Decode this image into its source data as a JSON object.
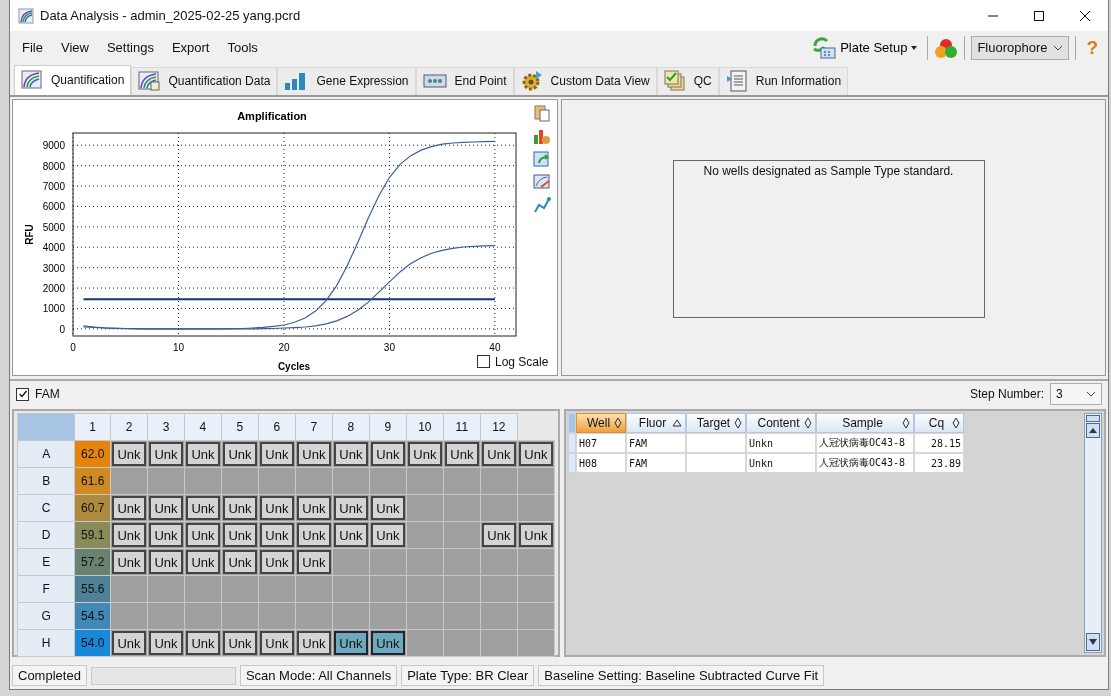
{
  "window": {
    "title": "Data Analysis - admin_2025-02-25 yang.pcrd"
  },
  "menu": [
    "File",
    "View",
    "Settings",
    "Export",
    "Tools"
  ],
  "toolbar": {
    "plate_setup": "Plate Setup",
    "fluorophore_select": "Fluorophore",
    "help": "?"
  },
  "tabs": [
    {
      "label": "Quantification",
      "selected": true
    },
    {
      "label": "Quantification Data",
      "selected": false
    },
    {
      "label": "Gene Expression",
      "selected": false
    },
    {
      "label": "End Point",
      "selected": false
    },
    {
      "label": "Custom Data View",
      "selected": false
    },
    {
      "label": "QC",
      "selected": false
    },
    {
      "label": "Run Information",
      "selected": false
    }
  ],
  "amplification": {
    "log_scale": {
      "label": "Log Scale",
      "checked": false
    },
    "chart_data": {
      "type": "line",
      "title": "Amplification",
      "xlabel": "Cycles",
      "ylabel": "RFU",
      "grid": true,
      "x": [
        1,
        2,
        3,
        4,
        5,
        6,
        7,
        8,
        9,
        10,
        11,
        12,
        13,
        14,
        15,
        16,
        17,
        18,
        19,
        20,
        21,
        22,
        23,
        24,
        25,
        26,
        27,
        28,
        29,
        30,
        31,
        32,
        33,
        34,
        35,
        36,
        37,
        38,
        39,
        40
      ],
      "series": [
        {
          "color": "#3b5f96",
          "values": [
            150,
            90,
            50,
            30,
            20,
            10,
            0,
            0,
            0,
            0,
            0,
            0,
            0,
            0,
            10,
            20,
            40,
            70,
            120,
            190,
            320,
            530,
            870,
            1380,
            2120,
            3090,
            4240,
            5440,
            6520,
            7420,
            8060,
            8480,
            8760,
            8930,
            9050,
            9110,
            9140,
            9160,
            9180,
            9190
          ]
        },
        {
          "color": "#3b5f96",
          "values": [
            100,
            70,
            40,
            20,
            10,
            0,
            0,
            0,
            0,
            0,
            0,
            0,
            0,
            0,
            0,
            0,
            0,
            10,
            20,
            40,
            60,
            90,
            150,
            250,
            390,
            610,
            910,
            1310,
            1800,
            2300,
            2790,
            3190,
            3490,
            3710,
            3850,
            3950,
            4010,
            4040,
            4070,
            4080
          ]
        }
      ],
      "xlim": [
        0,
        42
      ],
      "ylim": [
        -350,
        9600
      ],
      "xticks": [
        0,
        10,
        20,
        30,
        40
      ],
      "yticks": [
        0,
        1000,
        2000,
        3000,
        4000,
        5000,
        6000,
        7000,
        8000,
        9000
      ],
      "ref_lines": [
        {
          "axis": "y",
          "value": 1450
        }
      ]
    }
  },
  "standard_curve": {
    "message": "No wells designated as Sample Type standard."
  },
  "fluor_filter": {
    "label": "FAM",
    "checked": true
  },
  "step_number": {
    "label": "Step Number:",
    "value": "3"
  },
  "plate": {
    "columns": [
      "1",
      "2",
      "3",
      "4",
      "5",
      "6",
      "7",
      "8",
      "9",
      "10",
      "11",
      "12"
    ],
    "rows": [
      {
        "label": "A",
        "temp": "62.0",
        "color": "#e4840c",
        "wells": [
          {
            "kind": "sample",
            "label": "Unk",
            "selected": false
          },
          {
            "kind": "sample",
            "label": "Unk",
            "selected": false
          },
          {
            "kind": "sample",
            "label": "Unk",
            "selected": false
          },
          {
            "kind": "sample",
            "label": "Unk",
            "selected": false
          },
          {
            "kind": "sample",
            "label": "Unk",
            "selected": false
          },
          {
            "kind": "sample",
            "label": "Unk",
            "selected": false
          },
          {
            "kind": "sample",
            "label": "Unk",
            "selected": false
          },
          {
            "kind": "sample",
            "label": "Unk",
            "selected": false
          },
          {
            "kind": "sample",
            "label": "Unk",
            "selected": false
          },
          {
            "kind": "sample",
            "label": "Unk",
            "selected": false
          },
          {
            "kind": "sample",
            "label": "Unk",
            "selected": false
          },
          {
            "kind": "sample",
            "label": "Unk",
            "selected": false
          }
        ]
      },
      {
        "label": "B",
        "temp": "61.6",
        "color": "#cf8a24",
        "wells": [
          {
            "kind": "empty"
          },
          {
            "kind": "empty"
          },
          {
            "kind": "empty"
          },
          {
            "kind": "empty"
          },
          {
            "kind": "empty"
          },
          {
            "kind": "empty"
          },
          {
            "kind": "empty"
          },
          {
            "kind": "empty"
          },
          {
            "kind": "empty"
          },
          {
            "kind": "empty"
          },
          {
            "kind": "empty"
          },
          {
            "kind": "empty"
          }
        ]
      },
      {
        "label": "C",
        "temp": "60.7",
        "color": "#ad8a3e",
        "wells": [
          {
            "kind": "sample",
            "label": "Unk",
            "selected": false
          },
          {
            "kind": "sample",
            "label": "Unk",
            "selected": false
          },
          {
            "kind": "sample",
            "label": "Unk",
            "selected": false
          },
          {
            "kind": "sample",
            "label": "Unk",
            "selected": false
          },
          {
            "kind": "sample",
            "label": "Unk",
            "selected": false
          },
          {
            "kind": "sample",
            "label": "Unk",
            "selected": false
          },
          {
            "kind": "sample",
            "label": "Unk",
            "selected": false
          },
          {
            "kind": "sample",
            "label": "Unk",
            "selected": false
          },
          {
            "kind": "empty"
          },
          {
            "kind": "empty"
          },
          {
            "kind": "empty"
          },
          {
            "kind": "empty"
          }
        ]
      },
      {
        "label": "D",
        "temp": "59.1",
        "color": "#8a8a5a",
        "wells": [
          {
            "kind": "sample",
            "label": "Unk",
            "selected": false
          },
          {
            "kind": "sample",
            "label": "Unk",
            "selected": false
          },
          {
            "kind": "sample",
            "label": "Unk",
            "selected": false
          },
          {
            "kind": "sample",
            "label": "Unk",
            "selected": false
          },
          {
            "kind": "sample",
            "label": "Unk",
            "selected": false
          },
          {
            "kind": "sample",
            "label": "Unk",
            "selected": false
          },
          {
            "kind": "sample",
            "label": "Unk",
            "selected": false
          },
          {
            "kind": "sample",
            "label": "Unk",
            "selected": false
          },
          {
            "kind": "empty"
          },
          {
            "kind": "empty"
          },
          {
            "kind": "sample",
            "label": "Unk",
            "selected": false
          },
          {
            "kind": "sample",
            "label": "Unk",
            "selected": false
          }
        ]
      },
      {
        "label": "E",
        "temp": "57.2",
        "color": "#6a8270",
        "wells": [
          {
            "kind": "sample",
            "label": "Unk",
            "selected": false
          },
          {
            "kind": "sample",
            "label": "Unk",
            "selected": false
          },
          {
            "kind": "sample",
            "label": "Unk",
            "selected": false
          },
          {
            "kind": "sample",
            "label": "Unk",
            "selected": false
          },
          {
            "kind": "sample",
            "label": "Unk",
            "selected": false
          },
          {
            "kind": "sample",
            "label": "Unk",
            "selected": false
          },
          {
            "kind": "empty"
          },
          {
            "kind": "empty"
          },
          {
            "kind": "empty"
          },
          {
            "kind": "empty"
          },
          {
            "kind": "empty"
          },
          {
            "kind": "empty"
          }
        ]
      },
      {
        "label": "F",
        "temp": "55.6",
        "color": "#4f8296",
        "wells": [
          {
            "kind": "empty"
          },
          {
            "kind": "empty"
          },
          {
            "kind": "empty"
          },
          {
            "kind": "empty"
          },
          {
            "kind": "empty"
          },
          {
            "kind": "empty"
          },
          {
            "kind": "empty"
          },
          {
            "kind": "empty"
          },
          {
            "kind": "empty"
          },
          {
            "kind": "empty"
          },
          {
            "kind": "empty"
          },
          {
            "kind": "empty"
          }
        ]
      },
      {
        "label": "G",
        "temp": "54.5",
        "color": "#3f88b8",
        "wells": [
          {
            "kind": "empty"
          },
          {
            "kind": "empty"
          },
          {
            "kind": "empty"
          },
          {
            "kind": "empty"
          },
          {
            "kind": "empty"
          },
          {
            "kind": "empty"
          },
          {
            "kind": "empty"
          },
          {
            "kind": "empty"
          },
          {
            "kind": "empty"
          },
          {
            "kind": "empty"
          },
          {
            "kind": "empty"
          },
          {
            "kind": "empty"
          }
        ]
      },
      {
        "label": "H",
        "temp": "54.0",
        "color": "#1a88d8",
        "wells": [
          {
            "kind": "sample",
            "label": "Unk",
            "selected": false
          },
          {
            "kind": "sample",
            "label": "Unk",
            "selected": false
          },
          {
            "kind": "sample",
            "label": "Unk",
            "selected": false
          },
          {
            "kind": "sample",
            "label": "Unk",
            "selected": false
          },
          {
            "kind": "sample",
            "label": "Unk",
            "selected": false
          },
          {
            "kind": "sample",
            "label": "Unk",
            "selected": false
          },
          {
            "kind": "sample",
            "label": "Unk",
            "selected": true
          },
          {
            "kind": "sample",
            "label": "Unk",
            "selected": true
          },
          {
            "kind": "empty"
          },
          {
            "kind": "empty"
          },
          {
            "kind": "empty"
          },
          {
            "kind": "empty"
          }
        ]
      }
    ]
  },
  "results_table": {
    "columns": [
      {
        "label": "Well",
        "selected": true,
        "sorted": false
      },
      {
        "label": "Fluor",
        "selected": false,
        "sorted": true
      },
      {
        "label": "Target",
        "selected": false,
        "sorted": false
      },
      {
        "label": "Content",
        "selected": false,
        "sorted": false
      },
      {
        "label": "Sample",
        "selected": false,
        "sorted": false
      },
      {
        "label": "Cq",
        "selected": false,
        "sorted": false
      }
    ],
    "rows": [
      [
        "H07",
        "FAM",
        "",
        "Unkn",
        "人冠状病毒OC43-8",
        "28.15"
      ],
      [
        "H08",
        "FAM",
        "",
        "Unkn",
        "人冠状病毒OC43-8",
        "23.89"
      ]
    ]
  },
  "status_bar": [
    "Completed",
    "Scan Mode: All Channels",
    "Plate Type: BR Clear",
    "Baseline Setting: Baseline Subtracted Curve Fit"
  ]
}
